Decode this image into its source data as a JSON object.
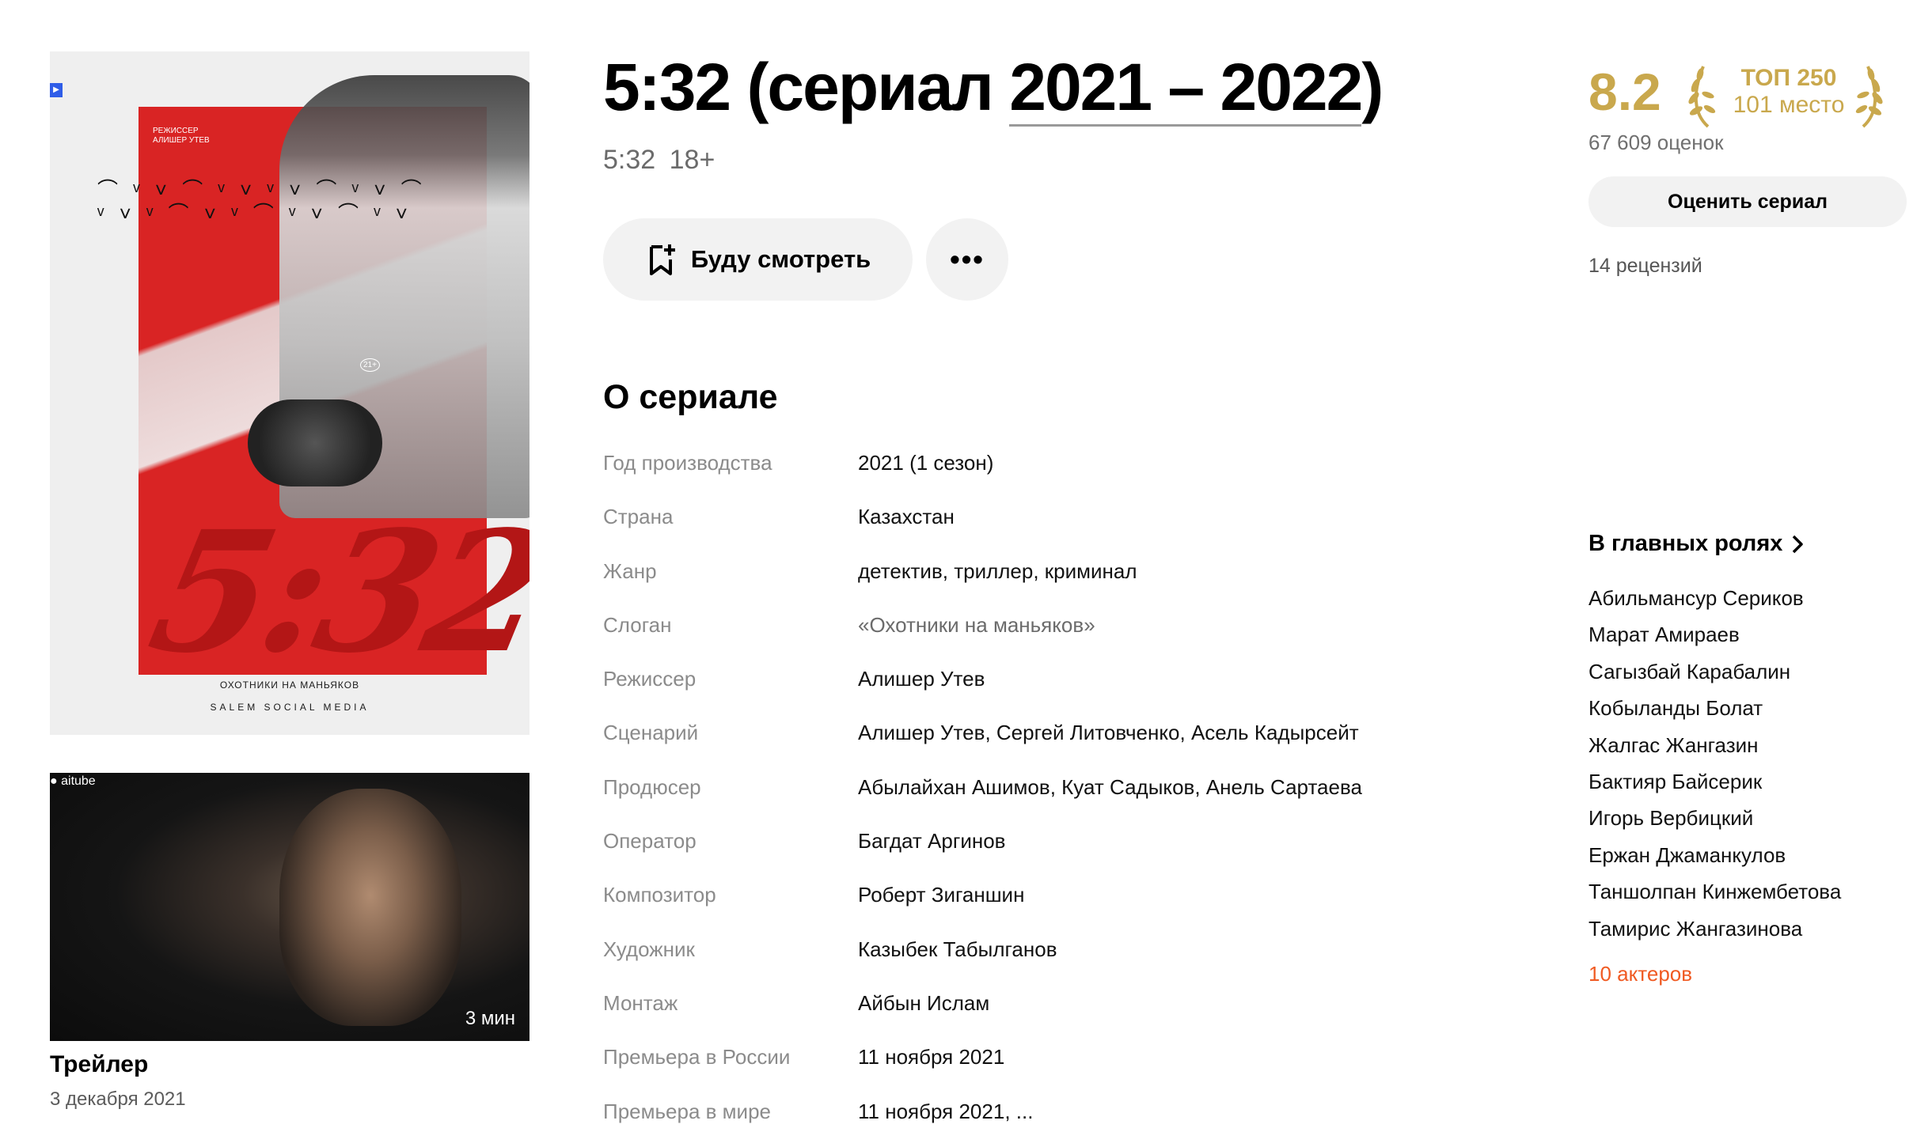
{
  "poster": {
    "director_caption": "РЕЖИССЕР",
    "director_name": "АЛИШЕР УТЕВ",
    "age_badge": "21+",
    "title_art": "5:32",
    "tagline": "ОХОТНИКИ НА МАНЬЯКОВ",
    "studio": "SALEM SOCIAL MEDIA"
  },
  "trailer": {
    "channel": "aitube",
    "duration": "3 мин",
    "title": "Трейлер",
    "date": "3 декабря 2021"
  },
  "header": {
    "title_prefix": "5:32 (сериал ",
    "title_years": "2021 – 2022",
    "title_suffix": ")",
    "original_title": "5:32",
    "age_rating": "18+"
  },
  "actions": {
    "watch_later": "Буду смотреть",
    "more": "•••"
  },
  "about": {
    "heading": "О сериале",
    "rows": [
      {
        "label": "Год производства",
        "value": "2021 (1 сезон)"
      },
      {
        "label": "Страна",
        "value": "Казахстан"
      },
      {
        "label": "Жанр",
        "value": "детектив, триллер, криминал"
      },
      {
        "label": "Слоган",
        "value": "«Охотники на маньяков»"
      },
      {
        "label": "Режиссер",
        "value": "Алишер Утев"
      },
      {
        "label": "Сценарий",
        "value": "Алишер Утев, Сергей Литовченко, Асель Кадырсейт"
      },
      {
        "label": "Продюсер",
        "value": "Абылайхан Ашимов, Куат Садыков, Анель Сартаева"
      },
      {
        "label": "Оператор",
        "value": "Багдат Аргинов"
      },
      {
        "label": "Композитор",
        "value": "Роберт Зиганшин"
      },
      {
        "label": "Художник",
        "value": "Казыбек Табылганов"
      },
      {
        "label": "Монтаж",
        "value": "Айбын Ислам"
      },
      {
        "label": "Премьера в России",
        "value": "11 ноября 2021"
      },
      {
        "label": "Премьера в мире",
        "value": "11 ноября 2021, ..."
      }
    ]
  },
  "rating": {
    "score": "8.2",
    "top_title": "ТОП 250",
    "top_place": "101 место",
    "votes": "67 609 оценок",
    "rate_button": "Оценить сериал",
    "reviews": "14 рецензий",
    "accent_color": "#c9a84d"
  },
  "cast": {
    "heading": "В главных ролях",
    "actors": [
      "Абильмансур Сериков",
      "Марат Амираев",
      "Сагызбай Карабалин",
      "Кобыланды Болат",
      "Жалгас Жангазин",
      "Бактияр Байсерик",
      "Игорь Вербицкий",
      "Ержан Джаманкулов",
      "Таншолпан Кинжембетова",
      "Тамирис Жангазинова"
    ],
    "more_link": "10 актеров",
    "more_color": "#f05a22"
  }
}
